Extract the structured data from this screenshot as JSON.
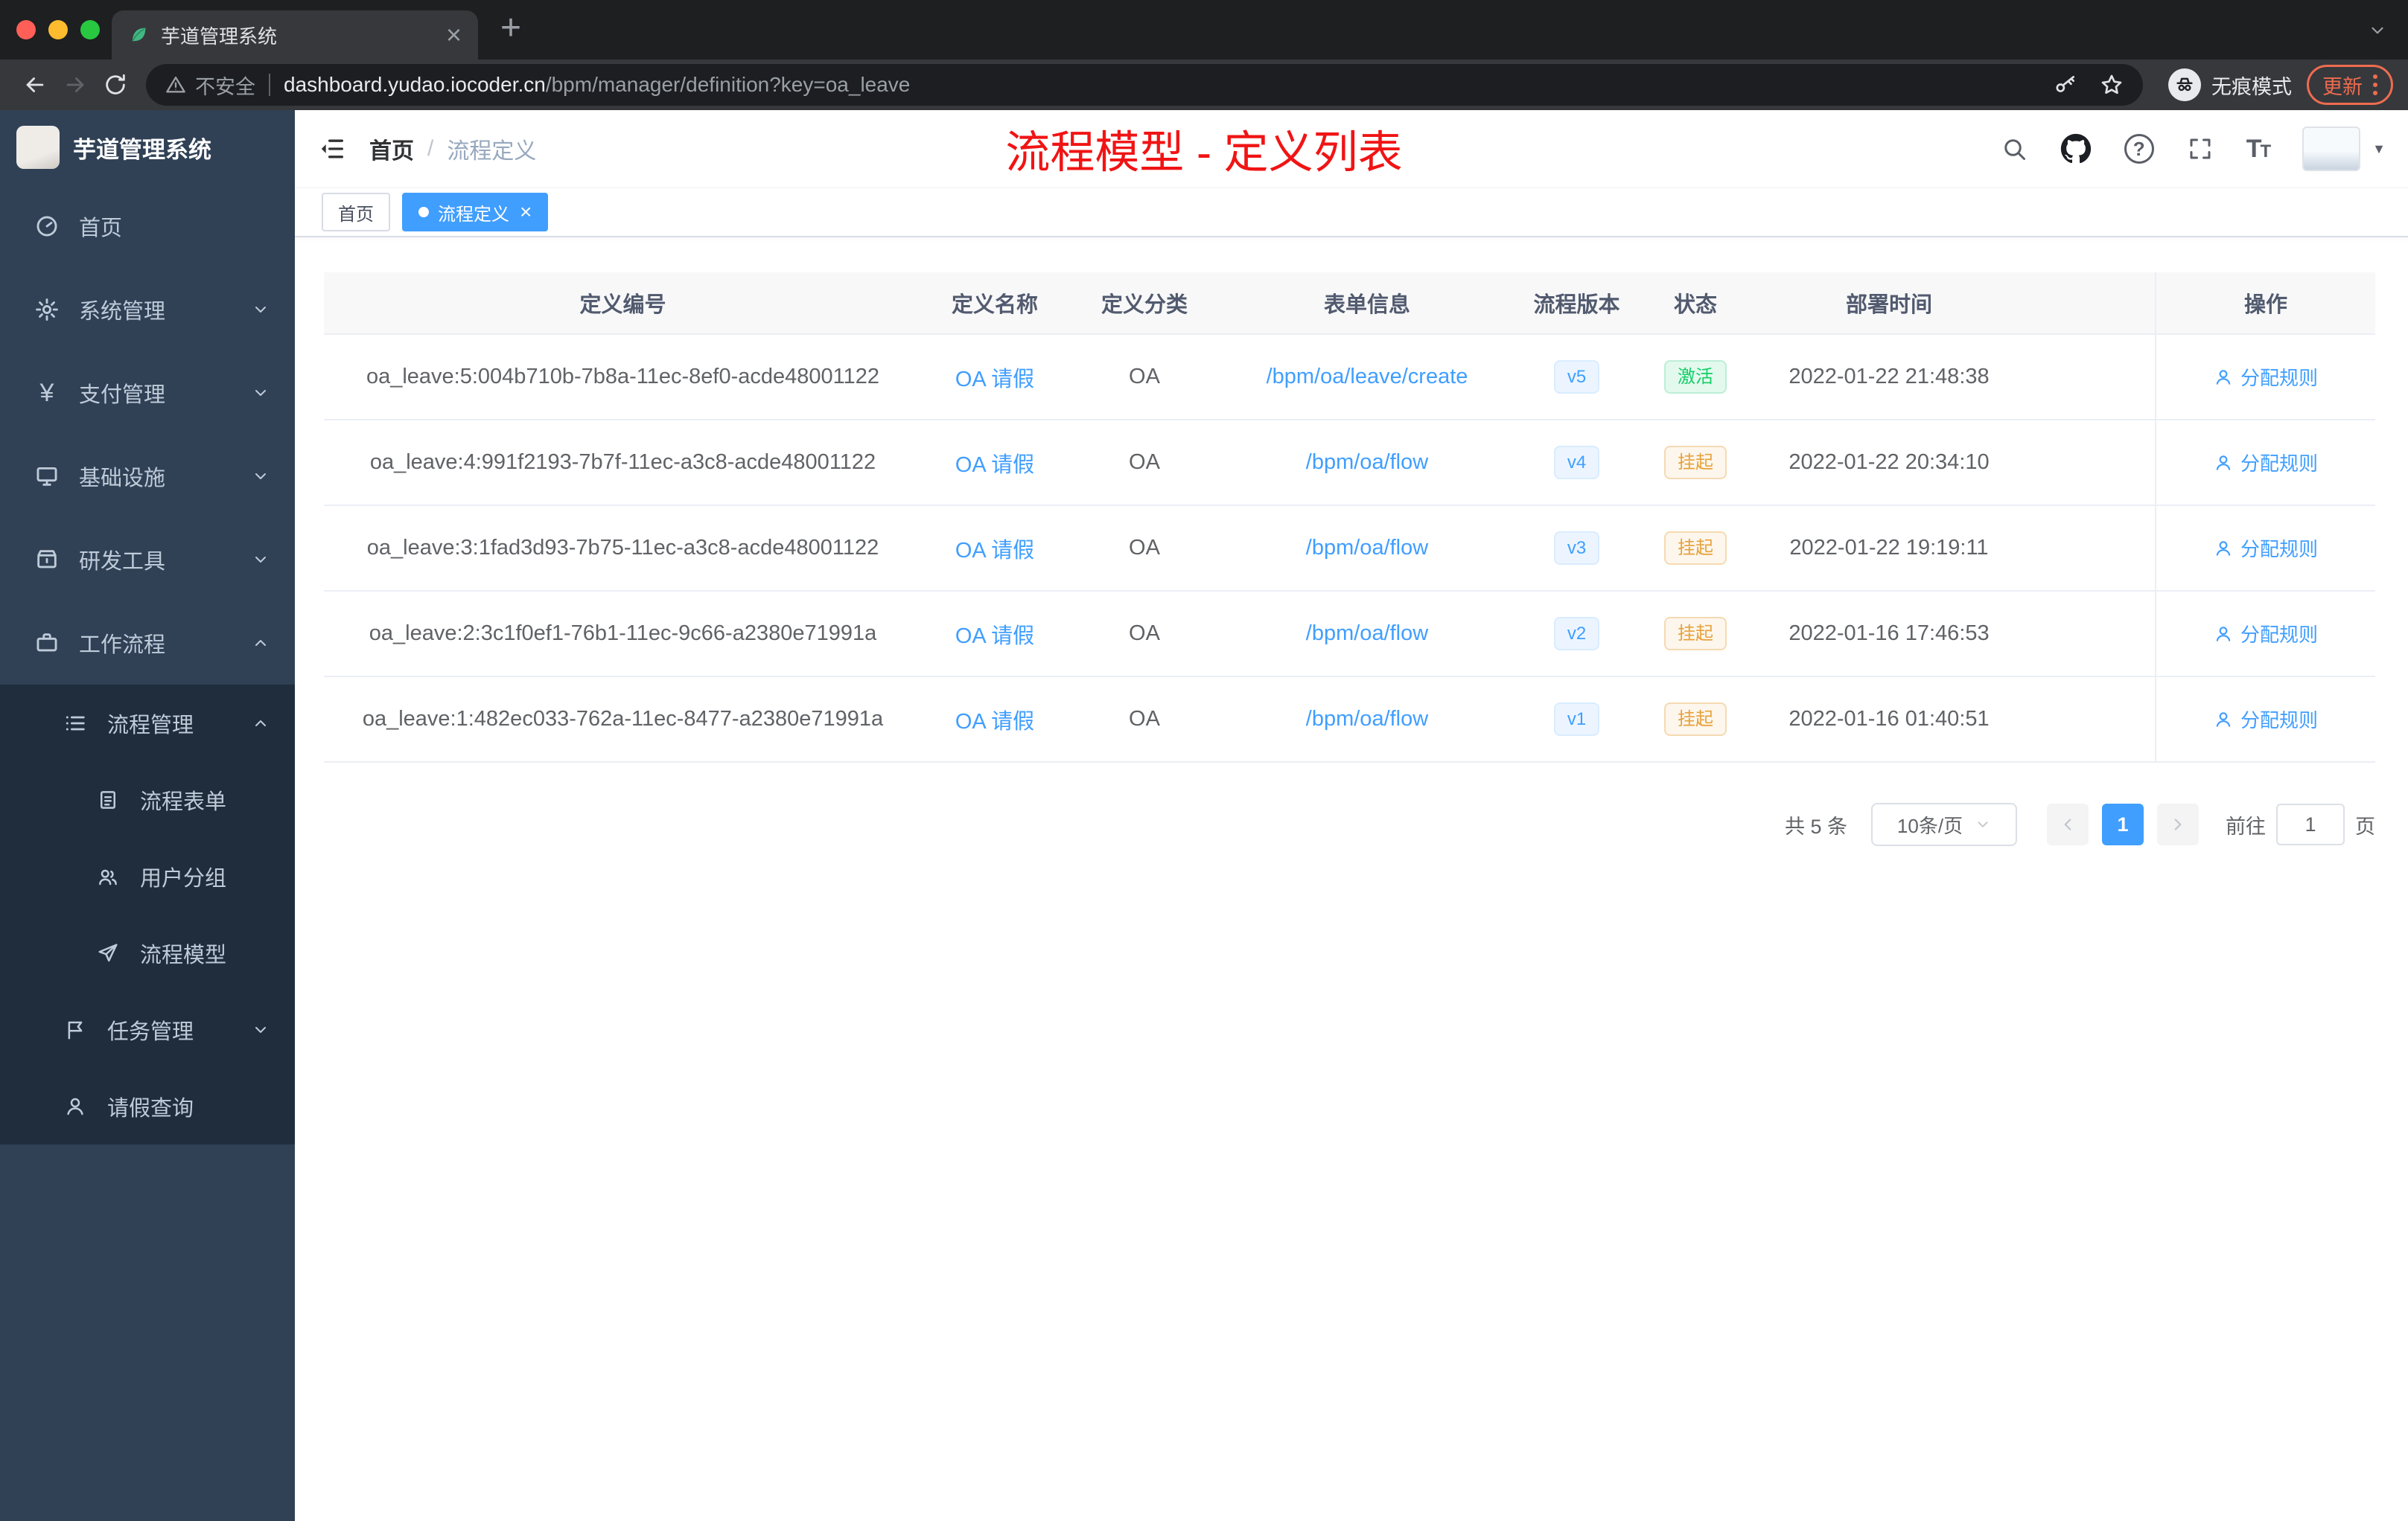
{
  "browser": {
    "tab_title": "芋道管理系统",
    "security_label": "不安全",
    "url_domain": "dashboard.yudao.iocoder.cn",
    "url_path": "/bpm/manager/definition?key=oa_leave",
    "incognito_label": "无痕模式",
    "update_label": "更新"
  },
  "sidebar": {
    "brand": "芋道管理系统",
    "items": [
      {
        "label": "首页"
      },
      {
        "label": "系统管理"
      },
      {
        "label": "支付管理"
      },
      {
        "label": "基础设施"
      },
      {
        "label": "研发工具"
      },
      {
        "label": "工作流程"
      },
      {
        "label": "流程管理"
      },
      {
        "label": "流程表单"
      },
      {
        "label": "用户分组"
      },
      {
        "label": "流程模型"
      },
      {
        "label": "任务管理"
      },
      {
        "label": "请假查询"
      }
    ]
  },
  "header": {
    "breadcrumb_home": "首页",
    "breadcrumb_separator": "/",
    "breadcrumb_current": "流程定义",
    "page_title": "流程模型 - 定义列表"
  },
  "tags": {
    "home": "首页",
    "active": "流程定义"
  },
  "table": {
    "columns": [
      "定义编号",
      "定义名称",
      "定义分类",
      "表单信息",
      "流程版本",
      "状态",
      "部署时间",
      "操作"
    ],
    "rows": [
      {
        "id": "oa_leave:5:004b710b-7b8a-11ec-8ef0-acde48001122",
        "name": "OA 请假",
        "category": "OA",
        "form": "/bpm/oa/leave/create",
        "version": "v5",
        "status": "激活",
        "deploy_time": "2022-01-22 21:48:38",
        "action": "分配规则"
      },
      {
        "id": "oa_leave:4:991f2193-7b7f-11ec-a3c8-acde48001122",
        "name": "OA 请假",
        "category": "OA",
        "form": "/bpm/oa/flow",
        "version": "v4",
        "status": "挂起",
        "deploy_time": "2022-01-22 20:34:10",
        "action": "分配规则"
      },
      {
        "id": "oa_leave:3:1fad3d93-7b75-11ec-a3c8-acde48001122",
        "name": "OA 请假",
        "category": "OA",
        "form": "/bpm/oa/flow",
        "version": "v3",
        "status": "挂起",
        "deploy_time": "2022-01-22 19:19:11",
        "action": "分配规则"
      },
      {
        "id": "oa_leave:2:3c1f0ef1-76b1-11ec-9c66-a2380e71991a",
        "name": "OA 请假",
        "category": "OA",
        "form": "/bpm/oa/flow",
        "version": "v2",
        "status": "挂起",
        "deploy_time": "2022-01-16 17:46:53",
        "action": "分配规则"
      },
      {
        "id": "oa_leave:1:482ec033-762a-11ec-8477-a2380e71991a",
        "name": "OA 请假",
        "category": "OA",
        "form": "/bpm/oa/flow",
        "version": "v1",
        "status": "挂起",
        "deploy_time": "2022-01-16 01:40:51",
        "action": "分配规则"
      }
    ]
  },
  "pagination": {
    "total_label": "共 5 条",
    "page_size": "10条/页",
    "current_page": "1",
    "goto_label": "前往",
    "goto_value": "1",
    "page_unit": "页"
  },
  "colors": {
    "accent": "#409eff",
    "success": "#13ce66",
    "warning": "#e6a23c",
    "title_red": "#f01414",
    "sidebar_bg": "#304156",
    "submenu_bg": "#1f2d3d"
  }
}
